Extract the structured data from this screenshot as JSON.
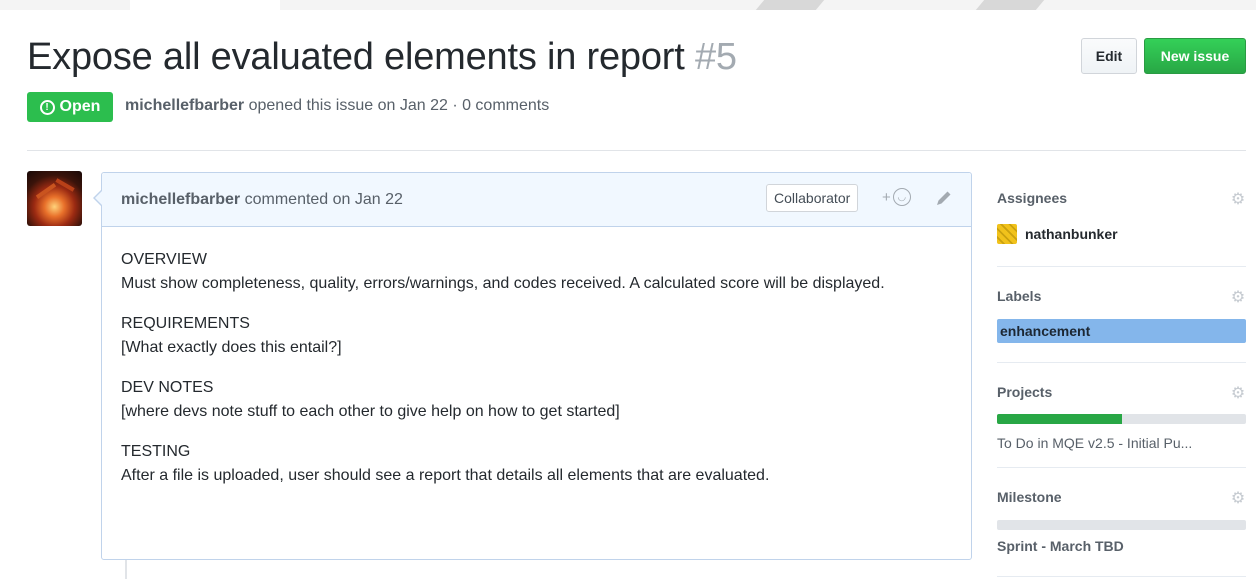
{
  "issue": {
    "title": "Expose all evaluated elements in report",
    "number": "#5",
    "state": "Open",
    "author": "michellefbarber",
    "meta_rest": "opened this issue on Jan 22 · 0 comments"
  },
  "header_buttons": {
    "edit": "Edit",
    "new_issue": "New issue"
  },
  "comment": {
    "author": "michellefbarber",
    "action": "commented on Jan 22",
    "badge": "Collaborator",
    "reaction_plus": "+",
    "sections": [
      {
        "heading": "OVERVIEW",
        "text": "Must show completeness, quality, errors/warnings, and codes received. A calculated score will be displayed."
      },
      {
        "heading": "REQUIREMENTS",
        "text": "[What exactly does this entail?]"
      },
      {
        "heading": "DEV NOTES",
        "text": "[where devs note stuff to each other to give help on how to get started]"
      },
      {
        "heading": "TESTING",
        "text": "After a file is uploaded, user should see a report that details all elements that are evaluated."
      }
    ]
  },
  "sidebar": {
    "assignees": {
      "heading": "Assignees",
      "user": "nathanbunker"
    },
    "labels": {
      "heading": "Labels",
      "label": "enhancement",
      "color": "#84b6eb"
    },
    "projects": {
      "heading": "Projects",
      "progress": 0.5,
      "name": "To Do in MQE v2.5 - Initial Pu..."
    },
    "milestone": {
      "heading": "Milestone",
      "progress": 0,
      "name": "Sprint - March TBD"
    }
  },
  "colors": {
    "open_green": "#2cbe4e",
    "new_issue_green": "#28a745",
    "comment_header_bg": "#f1f8ff"
  },
  "icons": [
    "issue-opened-icon",
    "smiley-icon",
    "pencil-icon",
    "gear-icon"
  ]
}
